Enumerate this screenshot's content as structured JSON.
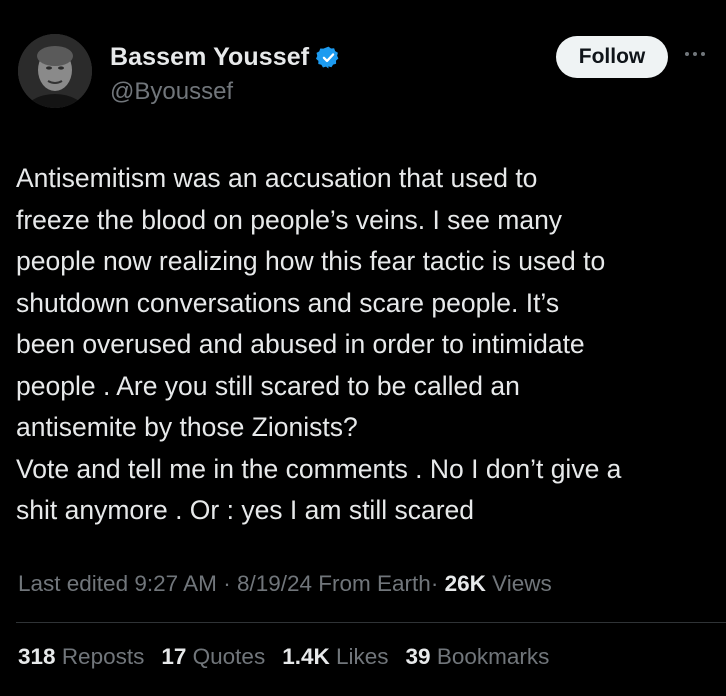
{
  "author": {
    "display_name": "Bassem Youssef",
    "handle": "@Byoussef",
    "verified": true,
    "verified_color": "#1d9bf0"
  },
  "actions": {
    "follow_label": "Follow",
    "more_icon": "more-horizontal-icon"
  },
  "tweet": {
    "text": "Antisemitism was an accusation that used to\nfreeze the blood on people’s veins. I see many\npeople now realizing how this fear tactic is used to\nshutdown conversations and scare people. It’s\nbeen overused and abused in order to intimidate\npeople . Are you still scared to be called an\nantisemite by those Zionists?\nVote and tell me in the comments . No I don’t give a\nshit anymore . Or : yes I am still scared"
  },
  "meta": {
    "edited_label": "Last edited",
    "time": "9:27 AM",
    "separator": "·",
    "date": "8/19/24",
    "source": "From Earth",
    "views_count": "26K",
    "views_label": "Views"
  },
  "stats": [
    {
      "count": "318",
      "label": "Reposts"
    },
    {
      "count": "17",
      "label": "Quotes"
    },
    {
      "count": "1.4K",
      "label": "Likes"
    },
    {
      "count": "39",
      "label": "Bookmarks"
    }
  ],
  "colors": {
    "background": "#000000",
    "text_primary": "#e7e9ea",
    "text_secondary": "#71767b",
    "follow_bg": "#eff3f4",
    "divider": "#2f3336"
  }
}
